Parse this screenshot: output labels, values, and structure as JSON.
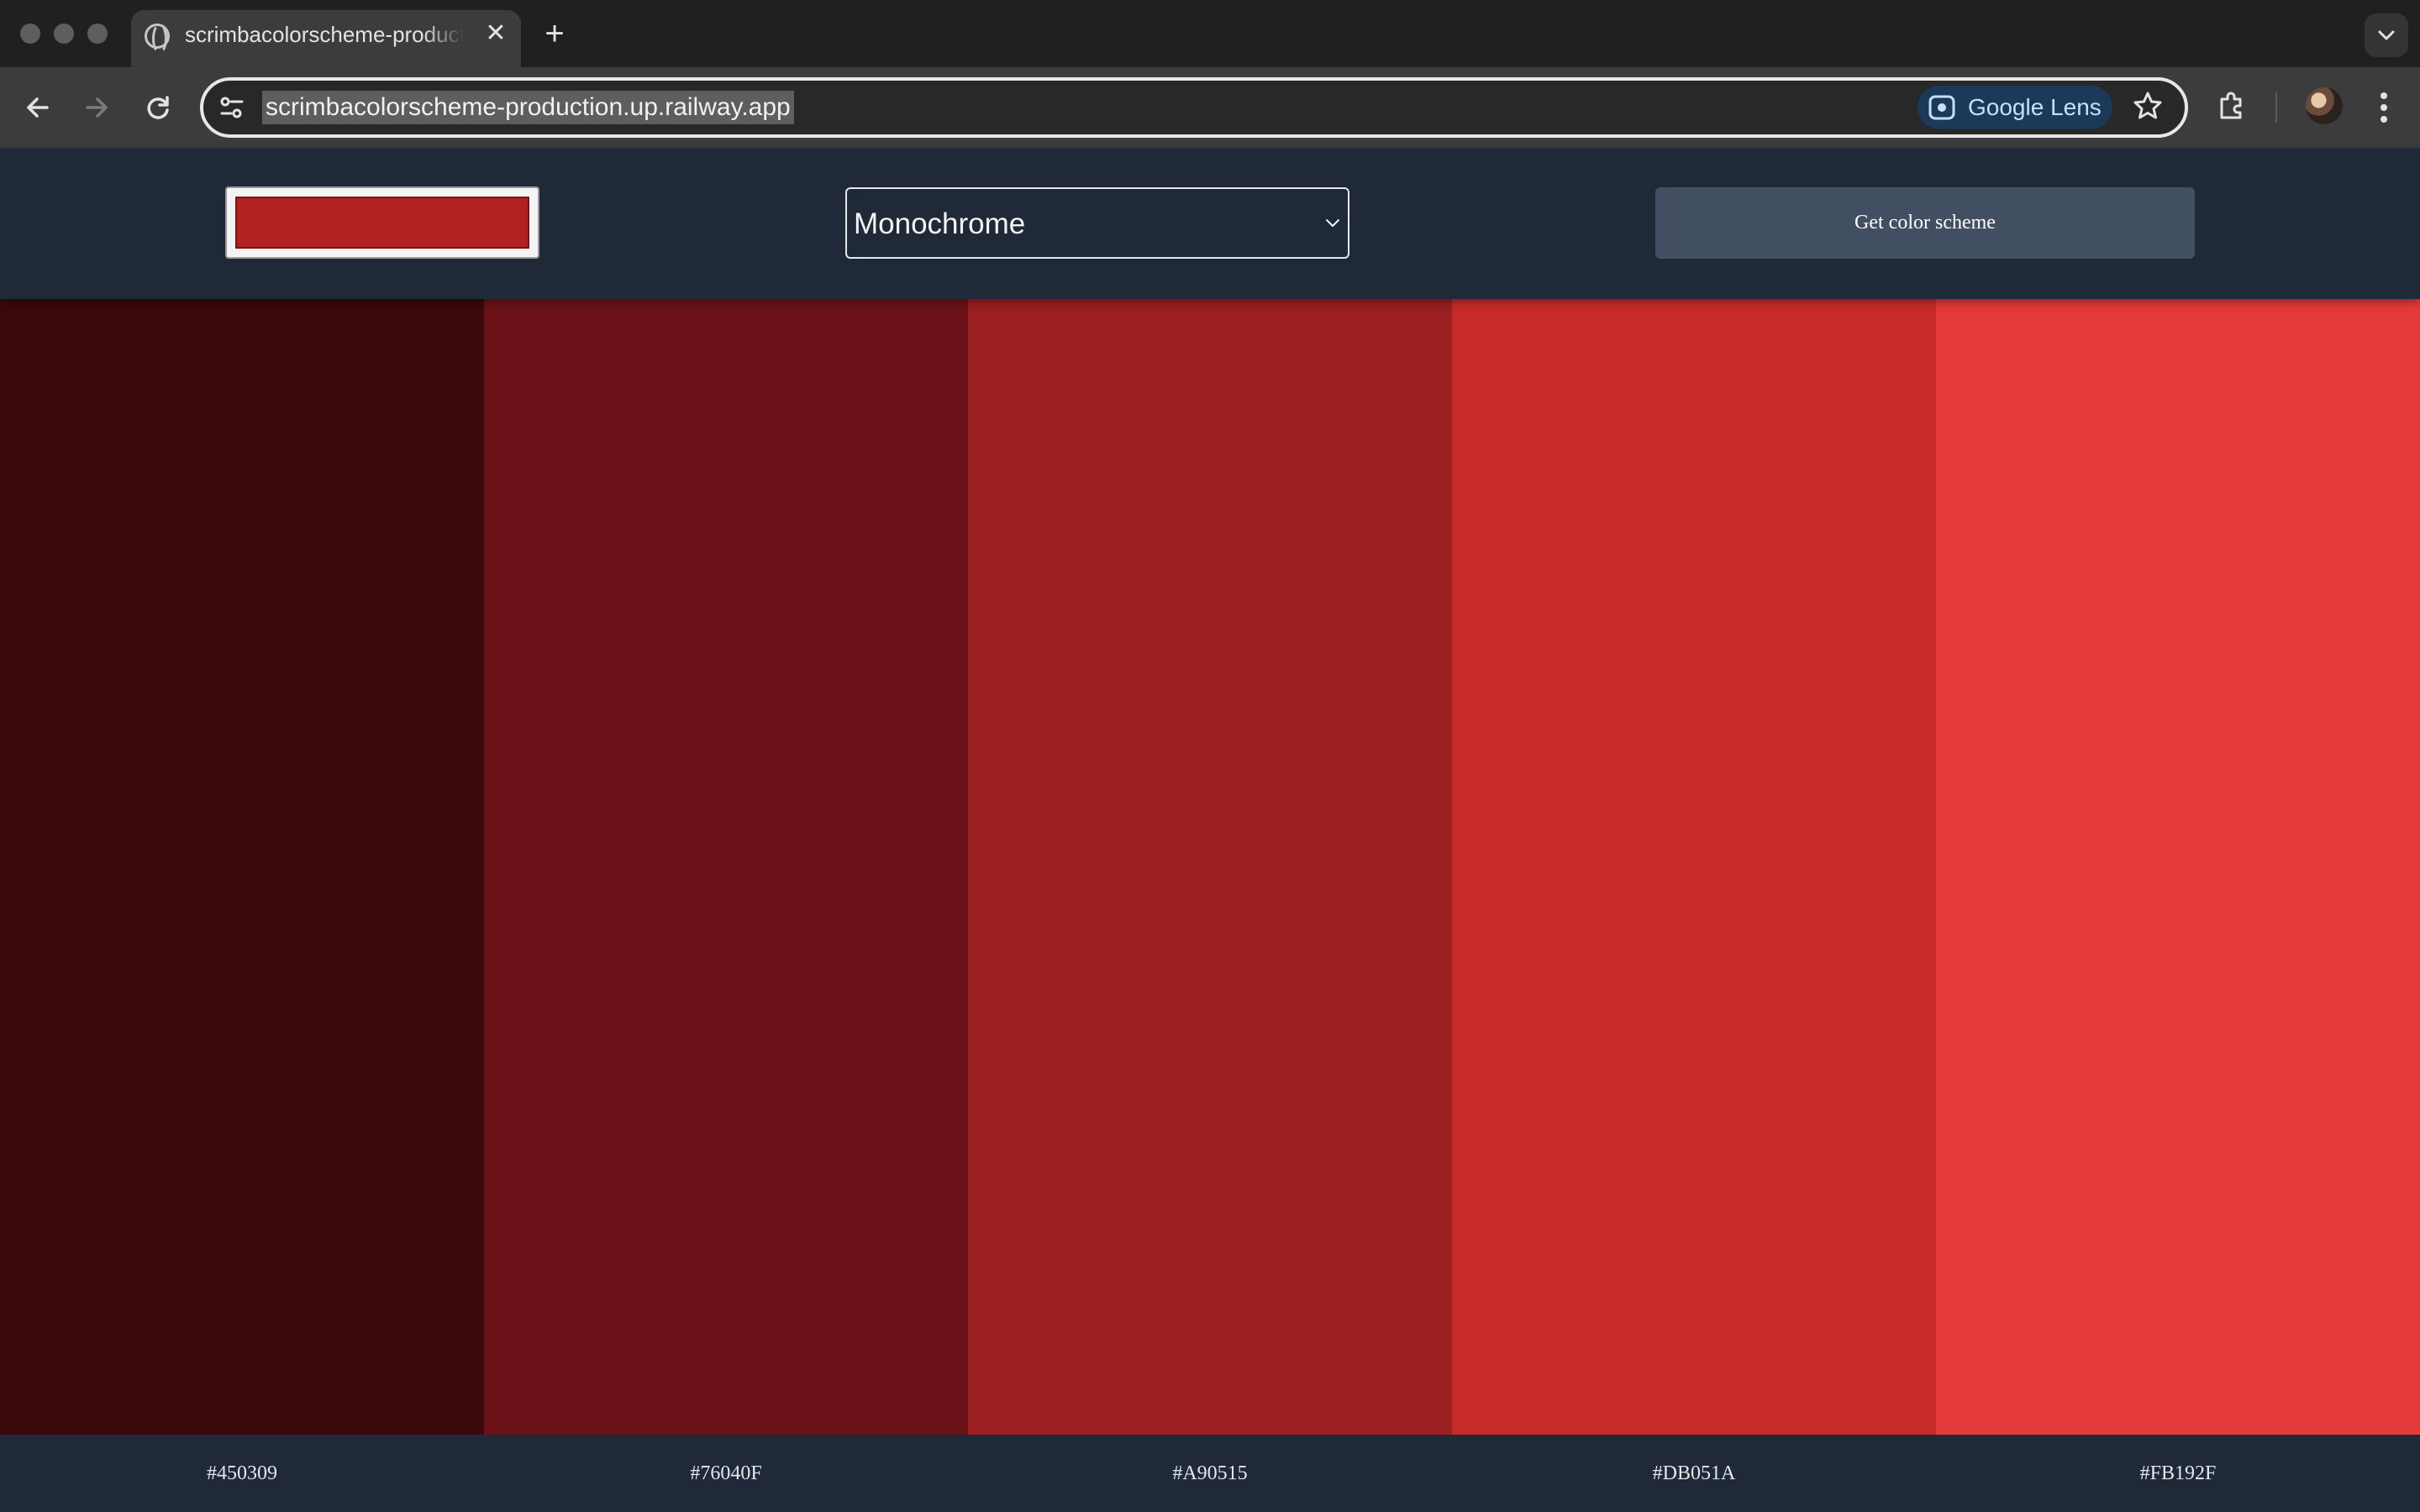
{
  "browser": {
    "tab_title": "scrimbacolorscheme-production.up.railway.app",
    "url": "scrimbacolorscheme-production.up.railway.app",
    "lens_label": "Google Lens"
  },
  "app": {
    "seed_color": "#B22222",
    "scheme_mode": "Monochrome",
    "get_button_label": "Get color scheme"
  },
  "palette": [
    {
      "hex": "#450309",
      "color": "#3b080c"
    },
    {
      "hex": "#76040F",
      "color": "#6b1218"
    },
    {
      "hex": "#A90515",
      "color": "#9b1f21"
    },
    {
      "hex": "#DB051A",
      "color": "#c72a29"
    },
    {
      "hex": "#FB192F",
      "color": "#e53a3a"
    }
  ],
  "colors": {
    "browser_frame": "#1f2020",
    "toolbar": "#3c3c3d",
    "app_bar": "#1f2937",
    "button": "#424f63"
  }
}
